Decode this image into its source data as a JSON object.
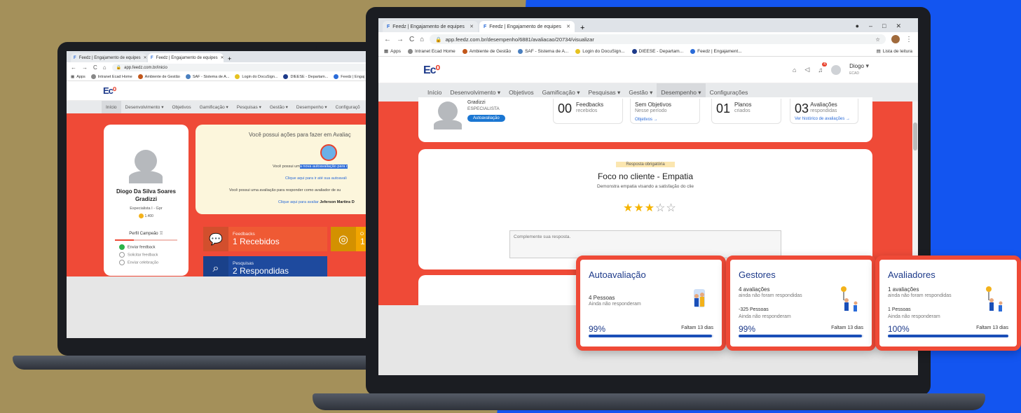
{
  "colors": {
    "accent_red": "#ef4a37",
    "brand_blue": "#1d3a8a",
    "bar_blue": "#1a4fb8",
    "star": "#f5b400"
  },
  "left": {
    "tabs": [
      {
        "label": "Feedz | Engajamento de equipes"
      },
      {
        "label": "Feedz | Engajamento de equipes"
      }
    ],
    "url": "app.feedz.com.br/inicio",
    "bookmarks": [
      "Apps",
      "Intranet Ecad Home",
      "Ambiente de Gestão",
      "SAF - Sistema de A...",
      "Login do DocuSign...",
      "DIEESE - Departam...",
      "Feedz | Engaj"
    ],
    "nav": [
      "Início",
      "Desenvolvimento ▾",
      "Objetivos",
      "Gamificação ▾",
      "Pesquisas ▾",
      "Gestão ▾",
      "Desempenho ▾",
      "Configuraçõ"
    ],
    "profile": {
      "name": "Diogo Da Silva Soares Gradizzi",
      "role": "Especialista I - Gpr",
      "coins": "1.400",
      "section": "Perfil Campeão",
      "checklist": [
        {
          "label": "Enviar feedback",
          "done": true
        },
        {
          "label": "Solicitar feedback",
          "done": false
        },
        {
          "label": "Enviar celebração",
          "done": false
        }
      ]
    },
    "notice": {
      "title": "Você possui ações para fazer em Avaliaç",
      "line1_prefix": "Você possui um",
      "line1_highlight": "a nova autoavaliação para r",
      "line2": "Clique aqui para ir até sua autoavali",
      "line3": "Você possui uma avaliação para responder como avaliador de su",
      "line4_prefix": "Clique aqui para avaliar",
      "line4_bold": "Jeferson Martins D"
    },
    "tiles": [
      {
        "label": "Feedbacks",
        "value": "1 Recebidos",
        "icon": "chat-icon",
        "color": "#ef5a34"
      },
      {
        "label": "Pesquisas",
        "value": "2 Respondidas",
        "icon": "search-icon",
        "color": "#1e4a9e"
      },
      {
        "label": "O",
        "value": "1",
        "icon": "target-icon",
        "color": "#f1a500"
      }
    ]
  },
  "right": {
    "tabs": [
      {
        "label": "Feedz | Engajamento de equipes"
      },
      {
        "label": "Feedz | Engajamento de equipes"
      }
    ],
    "url": "app.feedz.com.br/desempenho/6881/avaliacao/20734/visualizar",
    "bookmarks": [
      "Apps",
      "Intranet Ecad Home",
      "Ambiente de Gestão",
      "SAF - Sistema de A...",
      "Login do DocuSign...",
      "DIEESE - Departam...",
      "Feedz | Engajament..."
    ],
    "reading_list": "Lista de leitura",
    "user": {
      "name": "Diogo",
      "sub": "ECAD",
      "notif": "4"
    },
    "nav": [
      "Início",
      "Desenvolvimento ▾",
      "Objetivos",
      "Gamificação ▾",
      "Pesquisas ▾",
      "Gestão ▾",
      "Desempenho ▾",
      "Configurações"
    ],
    "summary": {
      "name": "Gradizzi",
      "role": "ESPECIALISTA",
      "badge": "Autoavaliação",
      "stats": [
        {
          "num": "00",
          "title": "Feedbacks",
          "sub": "recebidos",
          "link": ""
        },
        {
          "num": "",
          "title": "Sem Objetivos",
          "sub": "Nesse período",
          "link": "Objetivos →"
        },
        {
          "num": "01",
          "title": "Planos",
          "sub": "criados",
          "link": ""
        },
        {
          "num": "03",
          "title": "Avaliações",
          "sub": "respondidas",
          "link": "Ver histórico de avaliações →"
        }
      ]
    },
    "question": {
      "tag": "Resposta obrigatória",
      "title": "Foco no cliente - Empatia",
      "desc": "Demonstra empatia visando a satisfação do clie",
      "rating": 3,
      "max": 5,
      "placeholder": "Complemente sua resposta."
    }
  },
  "popups": [
    {
      "title": "Autoavaliação",
      "line1": "4 Pessoas",
      "line1b": "Ainda não responderam",
      "line2": "",
      "line2b": "",
      "percent": "99%",
      "progress": 0.99,
      "due": "Faltam 13 dias"
    },
    {
      "title": "Gestores",
      "line1": "4 avaliações",
      "line1b": "ainda não foram respondidas",
      "line2": "-325 Pessoas",
      "line2b": "Ainda não responderam",
      "percent": "99%",
      "progress": 0.99,
      "due": "Faltam 13 dias"
    },
    {
      "title": "Avaliadores",
      "line1": "1 avaliações",
      "line1b": "ainda não foram respondidas",
      "line2": "1 Pessoas",
      "line2b": "Ainda não responderam",
      "percent": "100%",
      "progress": 1.0,
      "due": "Faltam 13 dias"
    }
  ]
}
